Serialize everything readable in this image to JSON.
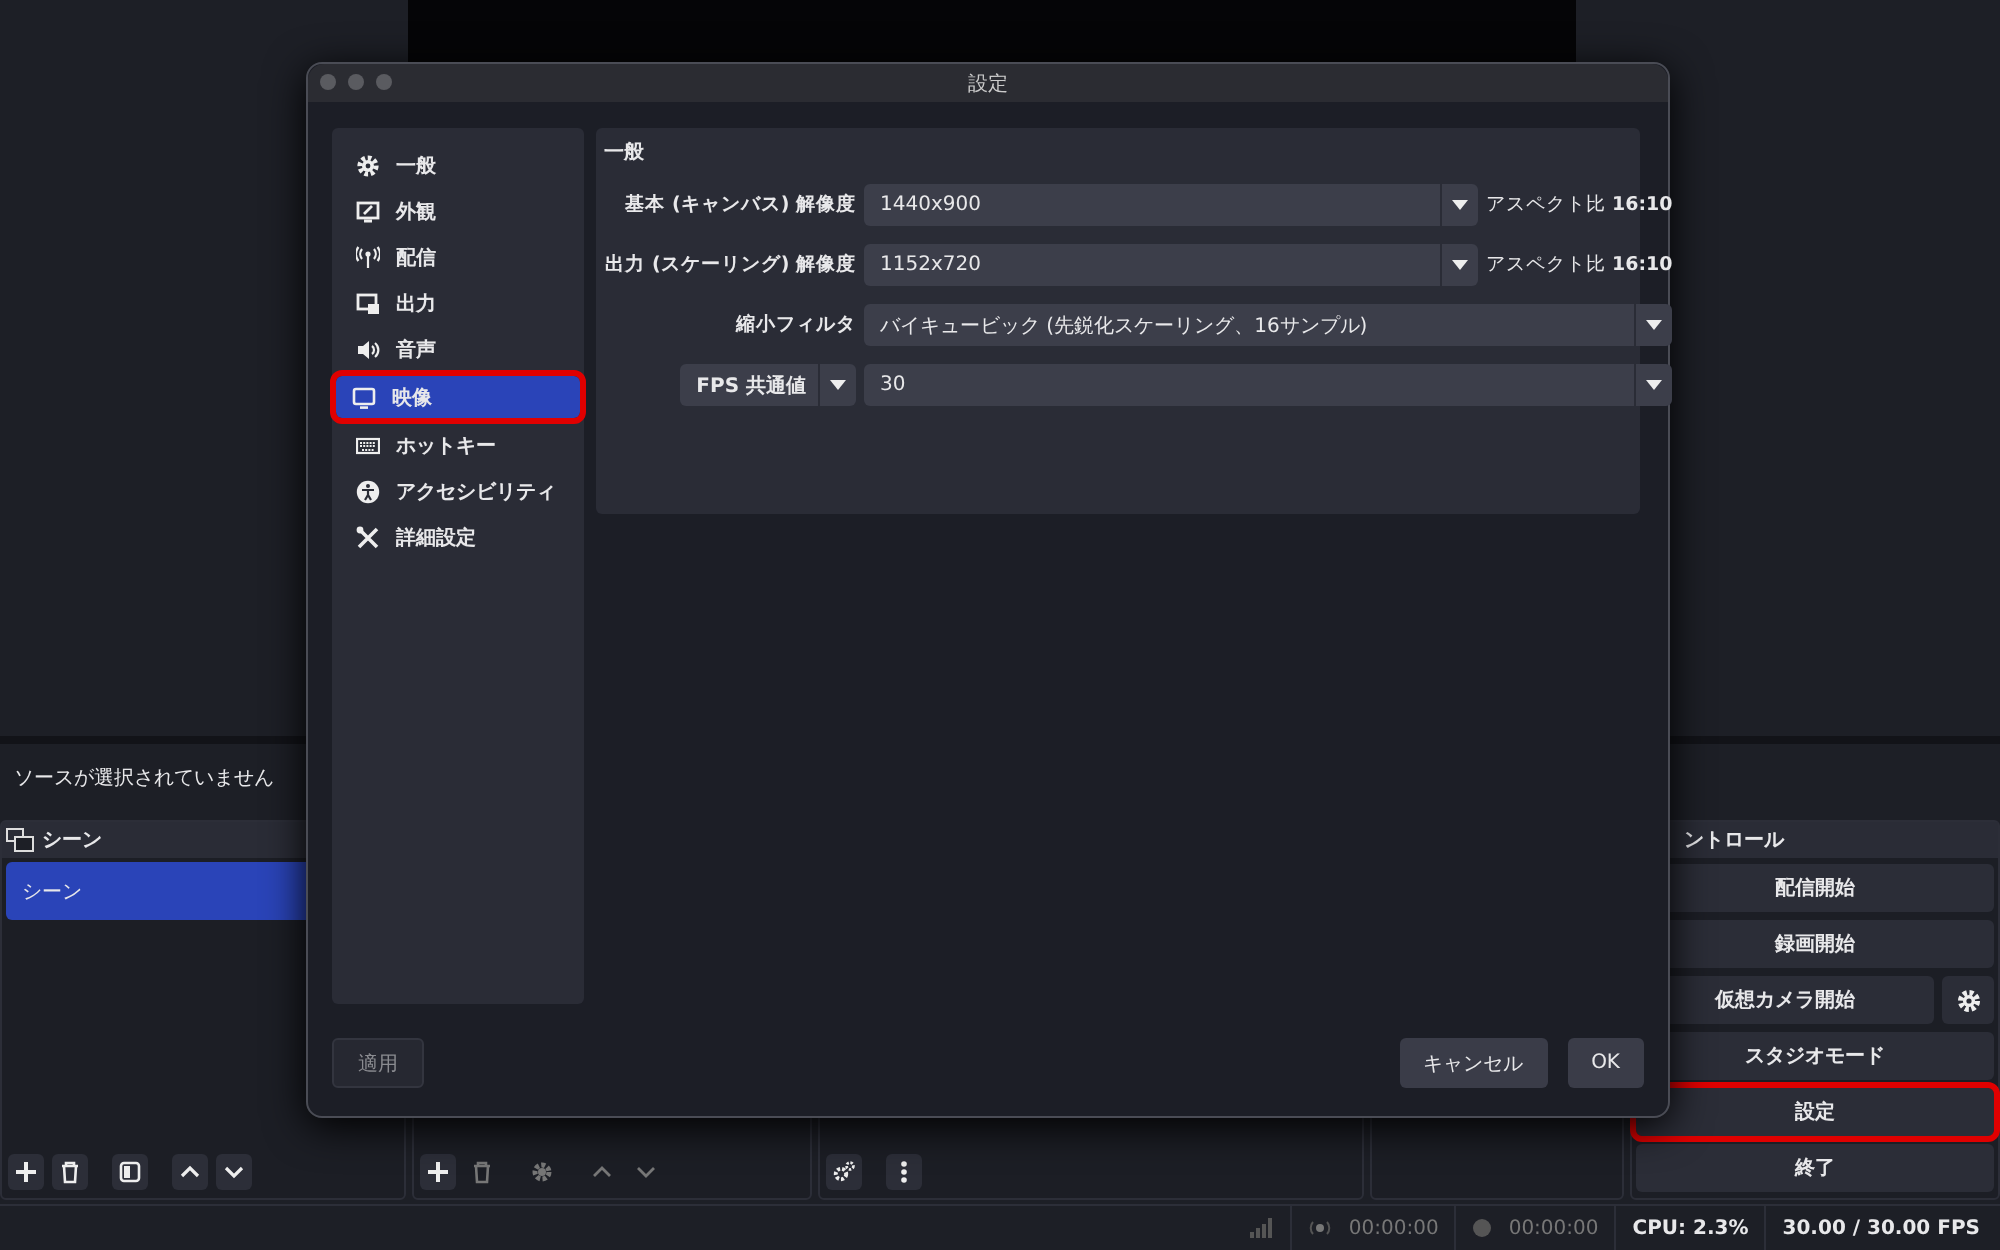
{
  "source_bar": {
    "text": "ソースが選択されていません"
  },
  "scenes": {
    "title": "シーン",
    "items": [
      {
        "label": "シーン",
        "selected": true
      }
    ]
  },
  "controls": {
    "title": "ントロール",
    "buttons": [
      {
        "label": "配信開始",
        "highlighted": false,
        "gear": false
      },
      {
        "label": "録画開始",
        "highlighted": false,
        "gear": false
      },
      {
        "label": "仮想カメラ開始",
        "highlighted": false,
        "gear": true
      },
      {
        "label": "スタジオモード",
        "highlighted": false,
        "gear": false
      },
      {
        "label": "設定",
        "highlighted": true,
        "gear": false
      },
      {
        "label": "終了",
        "highlighted": false,
        "gear": false
      }
    ]
  },
  "status_bar": {
    "stream_time": "00:00:00",
    "record_time": "00:00:00",
    "cpu": "CPU: 2.3%",
    "fps": "30.00 / 30.00 FPS"
  },
  "dialog": {
    "title": "設定",
    "sidebar": [
      {
        "label": "一般",
        "selected": false,
        "highlighted": false
      },
      {
        "label": "外観",
        "selected": false,
        "highlighted": false
      },
      {
        "label": "配信",
        "selected": false,
        "highlighted": false
      },
      {
        "label": "出力",
        "selected": false,
        "highlighted": false
      },
      {
        "label": "音声",
        "selected": false,
        "highlighted": false
      },
      {
        "label": "映像",
        "selected": true,
        "highlighted": true
      },
      {
        "label": "ホットキー",
        "selected": false,
        "highlighted": false
      },
      {
        "label": "アクセシビリティ",
        "selected": false,
        "highlighted": false
      },
      {
        "label": "詳細設定",
        "selected": false,
        "highlighted": false
      }
    ],
    "section": "一般",
    "rows": [
      {
        "kind": "select",
        "label": "基本 (キャンバス) 解像度",
        "value": "1440x900",
        "note": "アスペクト比 **16:10**"
      },
      {
        "kind": "select",
        "label": "出力 (スケーリング) 解像度",
        "value": "1152x720",
        "note": "アスペクト比 **16:10**"
      },
      {
        "kind": "select",
        "label": "縮小フィルタ",
        "value": "バイキュービック (先鋭化スケーリング、16サンプル)"
      },
      {
        "kind": "select_button",
        "label": "FPS 共通値",
        "value": "30"
      }
    ],
    "apply": "適用",
    "cancel": "キャンセル",
    "ok": "OK"
  }
}
